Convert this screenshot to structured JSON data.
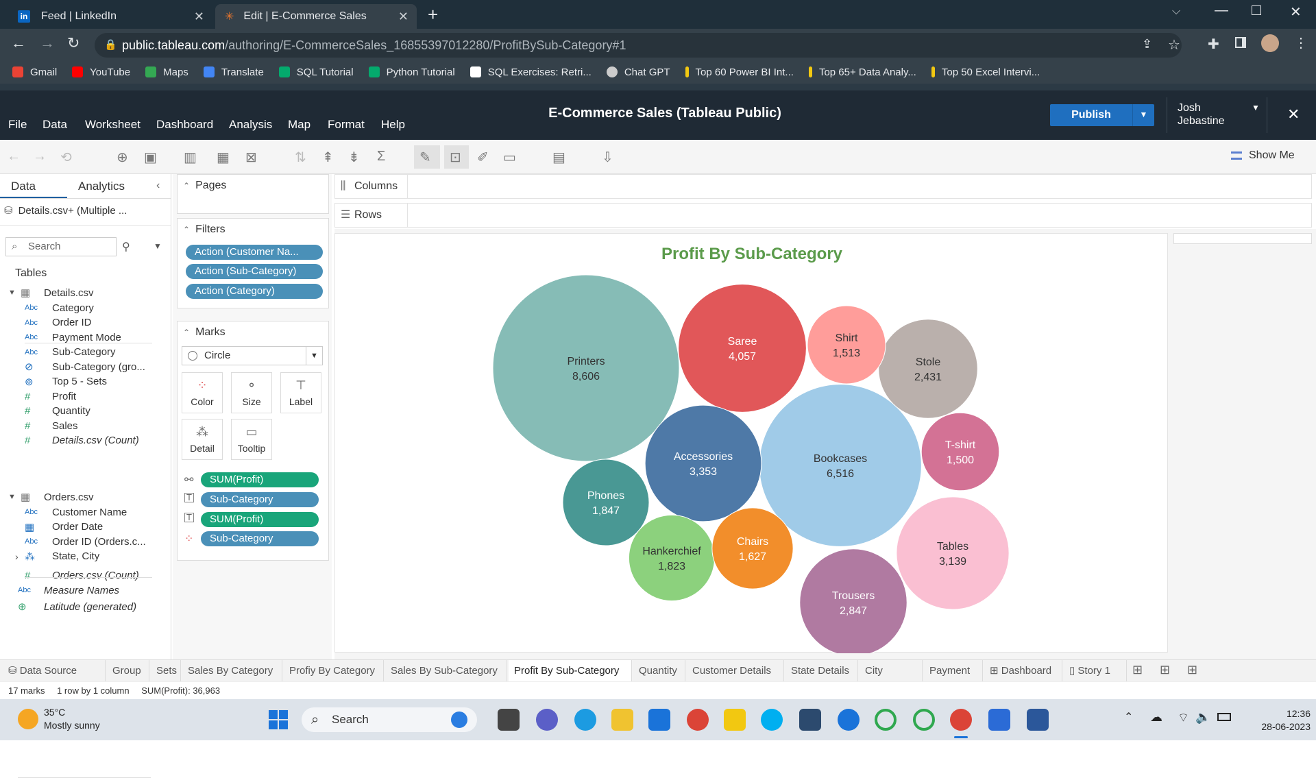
{
  "browser": {
    "tabs": [
      {
        "title": "Feed | LinkedIn"
      },
      {
        "title": "Edit | E-Commerce Sales"
      }
    ],
    "url_host": "public.tableau.com",
    "url_path": "/authoring/E-CommerceSales_16855397012280/ProfitBySub-Category#1",
    "bookmarks": [
      {
        "label": "Gmail",
        "color": "#ea4335"
      },
      {
        "label": "YouTube",
        "color": "#ff0000"
      },
      {
        "label": "Maps",
        "color": "#34a853"
      },
      {
        "label": "Translate",
        "color": "#4285f4"
      },
      {
        "label": "SQL Tutorial",
        "color": "#04aa6d"
      },
      {
        "label": "Python Tutorial",
        "color": "#04aa6d"
      },
      {
        "label": "SQL Exercises: Retri...",
        "color": "#ffffff"
      },
      {
        "label": "Chat GPT",
        "color": "#cccccc"
      },
      {
        "label": "Top 60 Power BI Int...",
        "color": "#f2c811"
      },
      {
        "label": "Top 65+ Data Analy...",
        "color": "#f2c811"
      },
      {
        "label": "Top 50 Excel Intervi...",
        "color": "#f2c811"
      }
    ]
  },
  "app": {
    "menu": [
      "File",
      "Data",
      "Worksheet",
      "Dashboard",
      "Analysis",
      "Map",
      "Format",
      "Help"
    ],
    "title": "E-Commerce Sales (Tableau Public)",
    "publish": "Publish",
    "user_first": "Josh",
    "user_last": "Jebastine",
    "show_me": "Show Me"
  },
  "data_pane": {
    "tab_data": "Data",
    "tab_analytics": "Analytics",
    "source": "Details.csv+ (Multiple ...",
    "search_placeholder": "Search",
    "tables_label": "Tables",
    "table1": "Details.csv",
    "table1_fields": [
      {
        "icon": "Abc",
        "name": "Category"
      },
      {
        "icon": "Abc",
        "name": "Order ID"
      },
      {
        "icon": "Abc",
        "name": "Payment Mode"
      },
      {
        "icon": "Abc",
        "name": "Sub-Category"
      },
      {
        "icon": "paperclip",
        "name": "Sub-Category (gro..."
      },
      {
        "icon": "set",
        "name": "Top 5 - Sets"
      },
      {
        "icon": "#",
        "name": "Profit"
      },
      {
        "icon": "#",
        "name": "Quantity"
      },
      {
        "icon": "#",
        "name": "Sales"
      },
      {
        "icon": "#",
        "name": "Details.csv (Count)"
      }
    ],
    "table2": "Orders.csv",
    "table2_fields": [
      {
        "icon": "Abc",
        "name": "Customer Name"
      },
      {
        "icon": "cal",
        "name": "Order Date"
      },
      {
        "icon": "Abc",
        "name": "Order ID (Orders.c..."
      },
      {
        "icon": "hier",
        "name": "State, City"
      },
      {
        "icon": "#",
        "name": "Orders.csv (Count)"
      }
    ],
    "extra_fields": [
      {
        "icon": "Abc",
        "name": "Measure Names"
      },
      {
        "icon": "globe",
        "name": "Latitude (generated)"
      }
    ]
  },
  "shelves": {
    "pages": "Pages",
    "filters": "Filters",
    "filter_pills": [
      "Action (Customer Na...",
      "Action (Sub-Category)",
      "Action (Category)"
    ],
    "marks": "Marks",
    "mark_type": "Circle",
    "mark_buttons": [
      "Color",
      "Size",
      "Label",
      "Detail",
      "Tooltip"
    ],
    "mark_pills": [
      {
        "label": "SUM(Profit)",
        "kind": "green"
      },
      {
        "label": "Sub-Category",
        "kind": "blue"
      },
      {
        "label": "SUM(Profit)",
        "kind": "green"
      },
      {
        "label": "Sub-Category",
        "kind": "blue"
      }
    ],
    "columns": "Columns",
    "rows": "Rows"
  },
  "chart_data": {
    "type": "bubble",
    "title": "Profit By Sub-Category",
    "measure": "SUM(Profit)",
    "bubbles": [
      {
        "label": "Printers",
        "value": 8606,
        "color": "#86bcb6"
      },
      {
        "label": "Bookcases",
        "value": 6516,
        "color": "#a0cbe8"
      },
      {
        "label": "Saree",
        "value": 4057,
        "color": "#e15759"
      },
      {
        "label": "Accessories",
        "value": 3353,
        "color": "#4e79a7"
      },
      {
        "label": "Tables",
        "value": 3139,
        "color": "#fabfd2"
      },
      {
        "label": "Trousers",
        "value": 2847,
        "color": "#b07aa1"
      },
      {
        "label": "Stole",
        "value": 2431,
        "color": "#bab0ac"
      },
      {
        "label": "Phones",
        "value": 1847,
        "color": "#499894"
      },
      {
        "label": "Hankerchief",
        "value": 1823,
        "color": "#8cd17d"
      },
      {
        "label": "Chairs",
        "value": 1627,
        "color": "#f28e2b"
      },
      {
        "label": "Shirt",
        "value": 1513,
        "color": "#ff9d9a"
      },
      {
        "label": "T-shirt",
        "value": 1500,
        "color": "#d37295"
      }
    ]
  },
  "sheet_tabs": [
    "Data Source",
    "Group",
    "Sets",
    "Sales By Category",
    "Profiy By Category",
    "Sales By Sub-Category",
    "Profit By Sub-Category",
    "Quantity",
    "Customer Details",
    "State Details",
    "City Details",
    "Payment",
    "Dashboard",
    "Story 1"
  ],
  "active_sheet": "Profit By Sub-Category",
  "status": {
    "marks": "17 marks",
    "dims": "1 row by 1 column",
    "sum": "SUM(Profit): 36,963"
  },
  "taskbar": {
    "temp": "35°C",
    "weather": "Mostly sunny",
    "search": "Search",
    "time": "12:36",
    "date": "28-06-2023"
  }
}
